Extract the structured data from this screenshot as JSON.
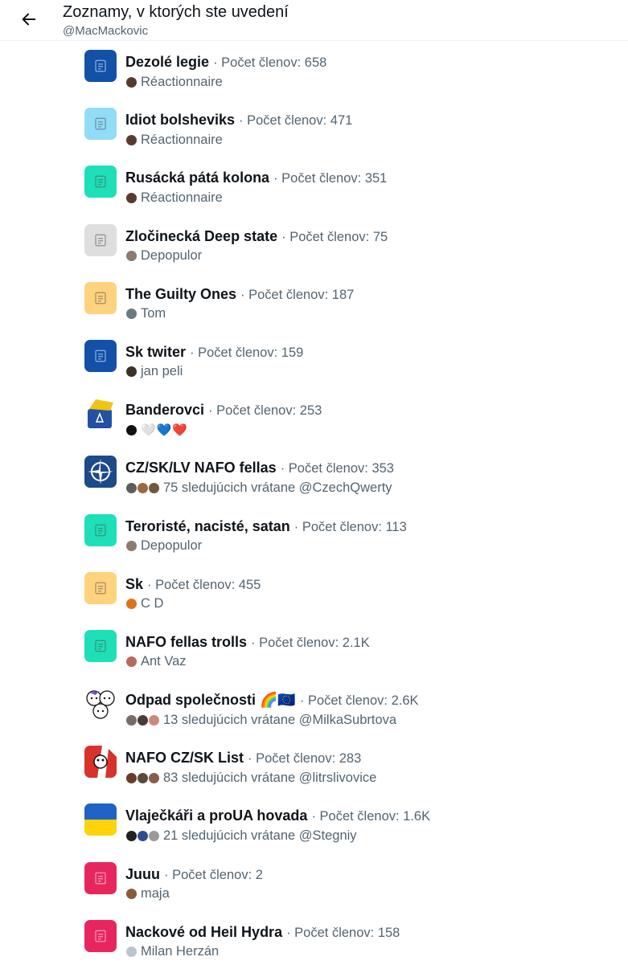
{
  "header": {
    "title": "Zoznamy, v ktorých ste uvedení",
    "handle": "@MacMackovic"
  },
  "colors": {
    "text": "#0f1419",
    "secondary": "#536471",
    "divider": "#eff3f4"
  },
  "lists": [
    {
      "name": "Dezolé legie",
      "members": "· Počet členov: 658",
      "owner": "Réactionnaire",
      "thumb": "doc",
      "thumb_color": "#1351a8",
      "avatars": [
        "#5b3a2e"
      ]
    },
    {
      "name": "Idiot bolsheviks",
      "members": "· Počet členov: 471",
      "owner": "Réactionnaire",
      "thumb": "doc",
      "thumb_color": "#91dcf6",
      "avatars": [
        "#5b3a2e"
      ]
    },
    {
      "name": "Rusácká pátá kolona",
      "members": "· Počet členov: 351",
      "owner": "Réactionnaire",
      "thumb": "doc",
      "thumb_color": "#1de0b8",
      "avatars": [
        "#5b3a2e"
      ]
    },
    {
      "name": "Zločinecká Deep state",
      "members": "· Počet členov: 75",
      "owner": "Depopulor",
      "thumb": "doc",
      "thumb_color": "#dedede",
      "avatars": [
        "#8c7b6e"
      ]
    },
    {
      "name": "The Guilty Ones",
      "members": "· Počet členov: 187",
      "owner": "Tom",
      "thumb": "doc",
      "thumb_color": "#ffd27d",
      "avatars": [
        "#6e7a82"
      ]
    },
    {
      "name": "Sk twiter",
      "members": "· Počet členov: 159",
      "owner": "jan peli",
      "thumb": "doc",
      "thumb_color": "#1351a8",
      "avatars": [
        "#3e2f28"
      ]
    },
    {
      "name": "Banderovci",
      "members": "· Počet členov: 253",
      "owner": "🤍💙❤️",
      "thumb": "banderovci",
      "thumb_color": "#2450a4",
      "avatars": [
        "#111111"
      ]
    },
    {
      "name": "CZ/SK/LV NAFO fellas",
      "members": "· Počet členov: 353",
      "owner": "75 sledujúcich vrátane @CzechQwerty",
      "thumb": "nato",
      "thumb_color": "#1e4a8a",
      "avatars": [
        "#5e5e5e",
        "#9b6a3a",
        "#6f5a3f"
      ]
    },
    {
      "name": "Teroristé, nacisté, satan",
      "members": "· Počet členov: 113",
      "owner": "Depopulor",
      "thumb": "doc",
      "thumb_color": "#1de0b8",
      "avatars": [
        "#8c7b6e"
      ]
    },
    {
      "name": "Sk",
      "members": "· Počet členov: 455",
      "owner": "C D",
      "thumb": "doc",
      "thumb_color": "#ffd27d",
      "avatars": [
        "#e0711c"
      ]
    },
    {
      "name": "NAFO fellas trolls",
      "members": "· Počet členov: 2.1K",
      "owner": "Ant Vaz",
      "thumb": "doc",
      "thumb_color": "#1de0b8",
      "avatars": [
        "#b86a5a"
      ]
    },
    {
      "name": "Odpad společnosti 🌈🇪🇺",
      "members": "· Počet členov: 2.6K",
      "owner": "13 sledujúcich vrátane @MilkaSubrtova",
      "thumb": "faces",
      "thumb_color": "#ffffff",
      "avatars": [
        "#7a6b66",
        "#4b3b38",
        "#c78b78"
      ]
    },
    {
      "name": "NAFO CZ/SK List",
      "members": "· Počet členov: 283",
      "owner": "83 sledujúcich vrátane @litrslivovice",
      "thumb": "nafo",
      "thumb_color": "#d9322b",
      "avatars": [
        "#6b3b2a",
        "#5a4a3a",
        "#8a5d4a"
      ]
    },
    {
      "name": "Vlaječkáři a proUA hovada",
      "members": "· Počet členov: 1.6K",
      "owner": "21 sledujúcich vrátane @Stegniy",
      "thumb": "ukraine",
      "thumb_color": "#1f63c6",
      "avatars": [
        "#222222",
        "#2e4e8f",
        "#9a9a9a"
      ]
    },
    {
      "name": "Juuu",
      "members": "· Počet členov: 2",
      "owner": "maja",
      "thumb": "doc",
      "thumb_color": "#e8265e",
      "avatars": [
        "#8a5a3a"
      ]
    },
    {
      "name": "Nackové od Heil Hydra",
      "members": "· Počet členov: 158",
      "owner": "Milan Herzán",
      "thumb": "doc",
      "thumb_color": "#e8265e",
      "avatars": [
        "#b8c4d0"
      ]
    }
  ]
}
